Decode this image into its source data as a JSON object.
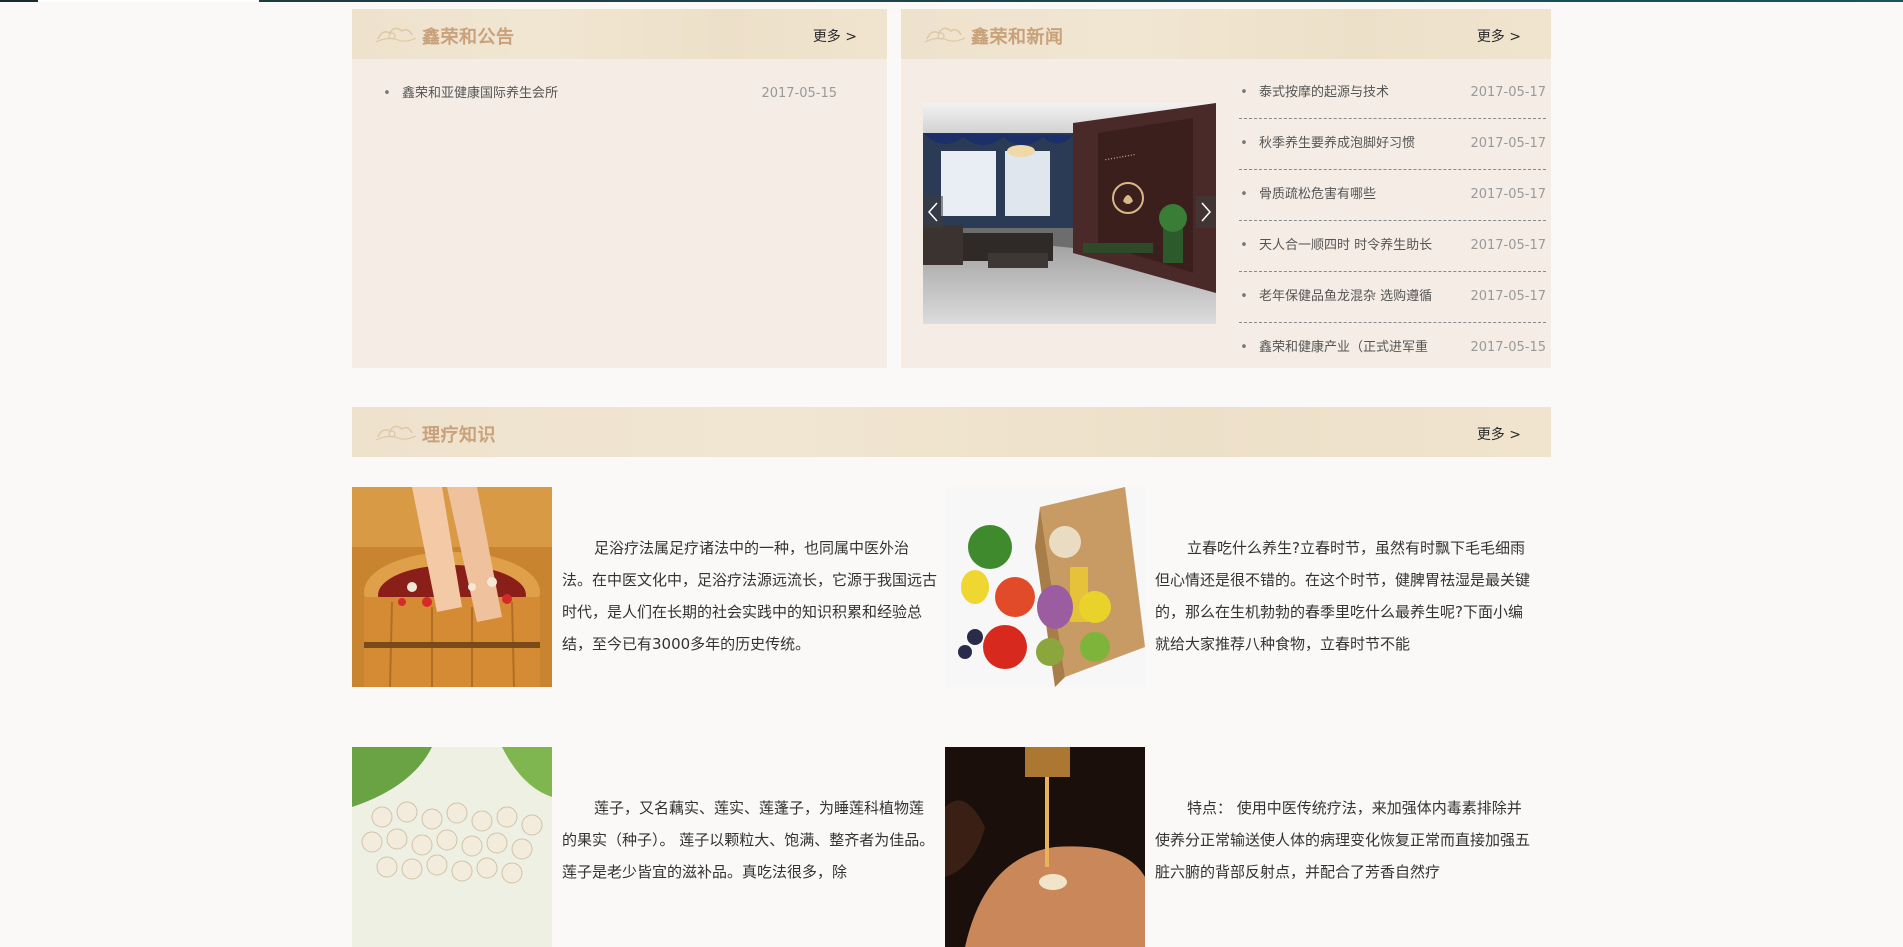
{
  "announcements": {
    "title": "鑫荣和公告",
    "more": "更多 >",
    "items": [
      {
        "title": "鑫荣和亚健康国际养生会所",
        "date": "2017-05-15"
      }
    ]
  },
  "news": {
    "title": "鑫荣和新闻",
    "more": "更多 >",
    "items": [
      {
        "title": "泰式按摩的起源与技术",
        "date": "2017-05-17"
      },
      {
        "title": "秋季养生要养成泡脚好习惯",
        "date": "2017-05-17"
      },
      {
        "title": "骨质疏松危害有哪些",
        "date": "2017-05-17"
      },
      {
        "title": "天人合一顺四时 时令养生助长",
        "date": "2017-05-17"
      },
      {
        "title": "老年保健品鱼龙混杂 选购遵循",
        "date": "2017-05-17"
      },
      {
        "title": "鑫荣和健康产业（正式进军重",
        "date": "2017-05-15"
      }
    ]
  },
  "knowledge": {
    "title": "理疗知识",
    "more": "更多 >",
    "articles": [
      {
        "text": "足浴疗法属足疗诸法中的一种，也同属中医外治法。在中医文化中，足浴疗法源远流长，它源于我国远古时代，是人们在长期的社会实践中的知识积累和经验总结，至今已有3000多年的历史传统。"
      },
      {
        "text": "立春吃什么养生?立春时节，虽然有时飘下毛毛细雨但心情还是很不错的。在这个时节，健脾胃祛湿是最关键的，那么在生机勃勃的春季里吃什么最养生呢?下面小编就给大家推荐八种食物，立春时节不能"
      },
      {
        "text": "莲子，又名藕实、莲实、莲蓬子，为睡莲科植物莲的果实（种子）。 莲子以颗粒大、饱满、整齐者为佳品。莲子是老少皆宜的滋补品。真吃法很多，除"
      },
      {
        "text": "特点： 使用中医传统疗法，来加强体内毒素排除并使养分正常输送使人体的病理变化恢复正常而直接加强五脏六腑的背部反射点，并配合了芳香自然疗"
      }
    ]
  },
  "colors": {
    "accent": "#c9a27b",
    "panel_bg": "#f5ede5",
    "header_bg": "#efe3cf"
  }
}
